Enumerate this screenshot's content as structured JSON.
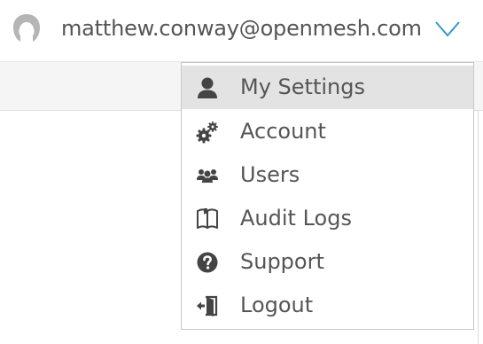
{
  "header": {
    "user_email": "matthew.conway@openmesh.com",
    "avatar_icon": "user-avatar-icon",
    "dropdown_icon": "chevron-down-icon",
    "accent_color": "#3399cc"
  },
  "menu": {
    "items": [
      {
        "label": "My Settings",
        "icon": "user-icon",
        "active": true
      },
      {
        "label": "Account",
        "icon": "gears-icon",
        "active": false
      },
      {
        "label": "Users",
        "icon": "users-icon",
        "active": false
      },
      {
        "label": "Audit Logs",
        "icon": "book-icon",
        "active": false
      },
      {
        "label": "Support",
        "icon": "question-circle-icon",
        "active": false
      },
      {
        "label": "Logout",
        "icon": "logout-icon",
        "active": false
      }
    ]
  }
}
